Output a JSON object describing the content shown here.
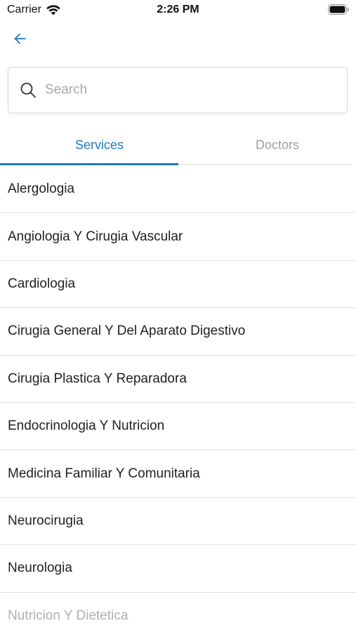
{
  "status_bar": {
    "carrier": "Carrier",
    "time": "2:26 PM"
  },
  "search": {
    "placeholder": "Search"
  },
  "tabs": [
    {
      "label": "Services",
      "active": true
    },
    {
      "label": "Doctors",
      "active": false
    }
  ],
  "colors": {
    "accent": "#1f7ac5",
    "inactive_tab": "#a0a0a0"
  },
  "services": [
    "Alergologia",
    "Angiologia Y Cirugia Vascular",
    "Cardiologia",
    "Cirugia General Y Del Aparato Digestivo",
    "Cirugia Plastica Y Reparadora",
    "Endocrinologia Y Nutricion",
    "Medicina Familiar Y Comunitaria",
    "Neurocirugia",
    "Neurologia",
    "Nutricion Y Dietetica"
  ]
}
